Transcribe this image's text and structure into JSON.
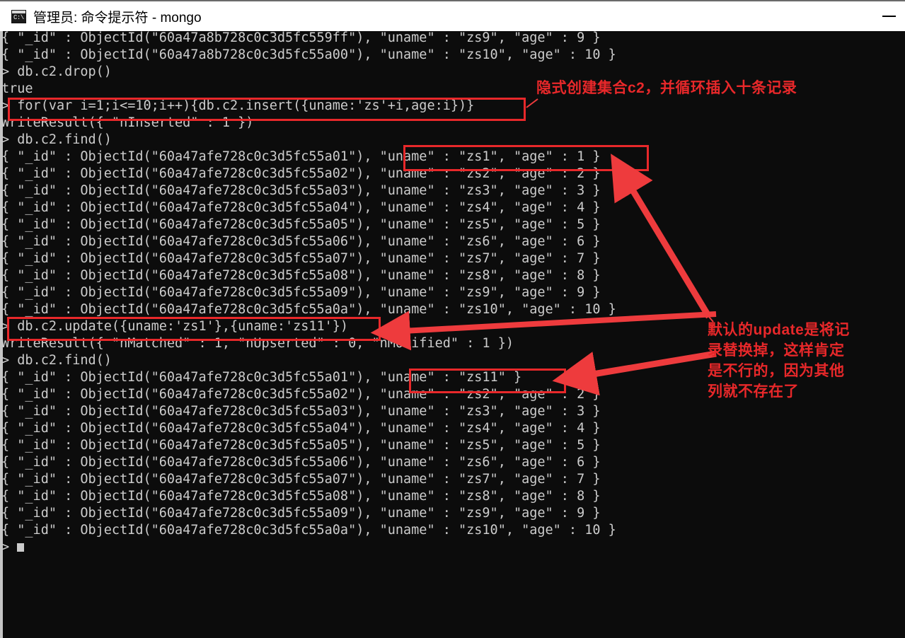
{
  "window": {
    "title": "管理员: 命令提示符 - mongo",
    "icon_name": "cmd-icon",
    "icon_glyph": "C:\\.",
    "minimize_label": "—"
  },
  "console": {
    "lines": [
      "{ \"_id\" : ObjectId(\"60a47a8b728c0c3d5fc559ff\"), \"uname\" : \"zs9\", \"age\" : 9 }",
      "{ \"_id\" : ObjectId(\"60a47a8b728c0c3d5fc55a00\"), \"uname\" : \"zs10\", \"age\" : 10 }",
      "> db.c2.drop()",
      "true",
      "> for(var i=1;i<=10;i++){db.c2.insert({uname:'zs'+i,age:i})}",
      "WriteResult({ \"nInserted\" : 1 })",
      "> db.c2.find()",
      "{ \"_id\" : ObjectId(\"60a47afe728c0c3d5fc55a01\"), \"uname\" : \"zs1\", \"age\" : 1 }",
      "{ \"_id\" : ObjectId(\"60a47afe728c0c3d5fc55a02\"), \"uname\" : \"zs2\", \"age\" : 2 }",
      "{ \"_id\" : ObjectId(\"60a47afe728c0c3d5fc55a03\"), \"uname\" : \"zs3\", \"age\" : 3 }",
      "{ \"_id\" : ObjectId(\"60a47afe728c0c3d5fc55a04\"), \"uname\" : \"zs4\", \"age\" : 4 }",
      "{ \"_id\" : ObjectId(\"60a47afe728c0c3d5fc55a05\"), \"uname\" : \"zs5\", \"age\" : 5 }",
      "{ \"_id\" : ObjectId(\"60a47afe728c0c3d5fc55a06\"), \"uname\" : \"zs6\", \"age\" : 6 }",
      "{ \"_id\" : ObjectId(\"60a47afe728c0c3d5fc55a07\"), \"uname\" : \"zs7\", \"age\" : 7 }",
      "{ \"_id\" : ObjectId(\"60a47afe728c0c3d5fc55a08\"), \"uname\" : \"zs8\", \"age\" : 8 }",
      "{ \"_id\" : ObjectId(\"60a47afe728c0c3d5fc55a09\"), \"uname\" : \"zs9\", \"age\" : 9 }",
      "{ \"_id\" : ObjectId(\"60a47afe728c0c3d5fc55a0a\"), \"uname\" : \"zs10\", \"age\" : 10 }",
      "> db.c2.update({uname:'zs1'},{uname:'zs11'})",
      "WriteResult({ \"nMatched\" : 1, \"nUpserted\" : 0, \"nModified\" : 1 })",
      "> db.c2.find()",
      "{ \"_id\" : ObjectId(\"60a47afe728c0c3d5fc55a01\"), \"uname\" : \"zs11\" }",
      "{ \"_id\" : ObjectId(\"60a47afe728c0c3d5fc55a02\"), \"uname\" : \"zs2\", \"age\" : 2 }",
      "{ \"_id\" : ObjectId(\"60a47afe728c0c3d5fc55a03\"), \"uname\" : \"zs3\", \"age\" : 3 }",
      "{ \"_id\" : ObjectId(\"60a47afe728c0c3d5fc55a04\"), \"uname\" : \"zs4\", \"age\" : 4 }",
      "{ \"_id\" : ObjectId(\"60a47afe728c0c3d5fc55a05\"), \"uname\" : \"zs5\", \"age\" : 5 }",
      "{ \"_id\" : ObjectId(\"60a47afe728c0c3d5fc55a06\"), \"uname\" : \"zs6\", \"age\" : 6 }",
      "{ \"_id\" : ObjectId(\"60a47afe728c0c3d5fc55a07\"), \"uname\" : \"zs7\", \"age\" : 7 }",
      "{ \"_id\" : ObjectId(\"60a47afe728c0c3d5fc55a08\"), \"uname\" : \"zs8\", \"age\" : 8 }",
      "{ \"_id\" : ObjectId(\"60a47afe728c0c3d5fc55a09\"), \"uname\" : \"zs9\", \"age\" : 9 }",
      "{ \"_id\" : ObjectId(\"60a47afe728c0c3d5fc55a0a\"), \"uname\" : \"zs10\", \"age\" : 10 }"
    ],
    "prompt_symbol": ">"
  },
  "annotations": {
    "color": "#e8282a",
    "note_top": "隐式创建集合c2，并循环插入十条记录",
    "note_right_lines": [
      "默认的update是将记",
      "录替换掉，这样肯定",
      "是不行的，因为其他",
      "列就不存在了"
    ],
    "highlight_for_loop": "for(var i=1;i<=10;i++){db.c2.insert({uname:'zs'+i,age:i})}",
    "highlight_first_record": "\"uname\" : \"zs1\", \"age\" : 1 }",
    "highlight_update_cmd": "db.c2.update({uname:'zs1'},{uname:'zs11'})",
    "highlight_updated_record": "\"uname\" : \"zs11\" }"
  }
}
